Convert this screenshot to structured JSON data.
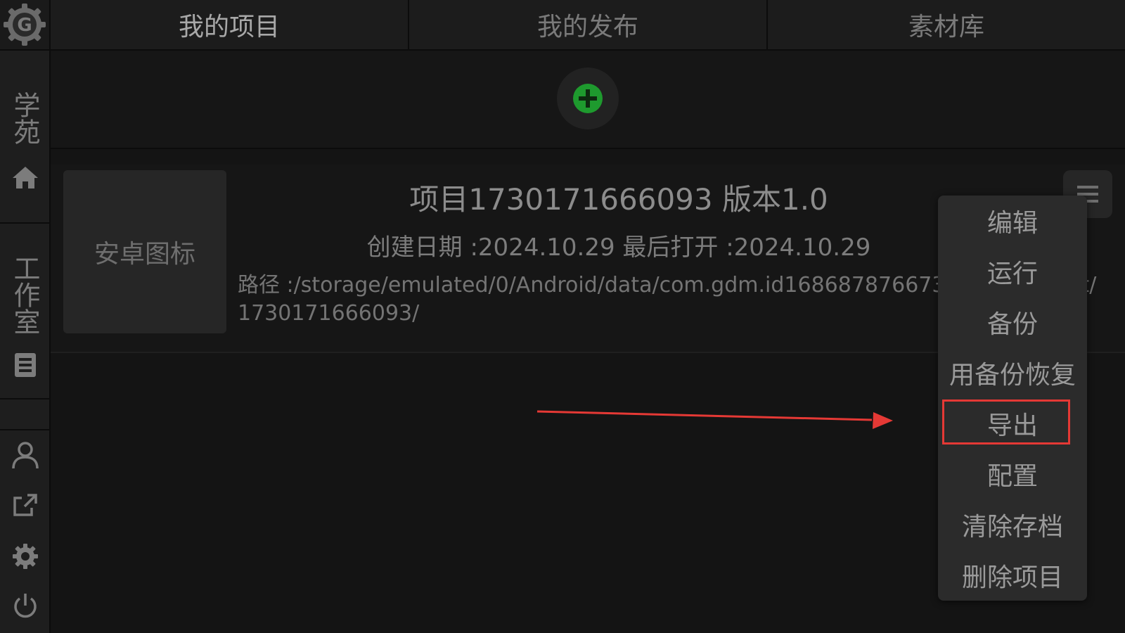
{
  "tabs": [
    {
      "label": "我的项目",
      "active": true
    },
    {
      "label": "我的发布",
      "active": false
    },
    {
      "label": "素材库",
      "active": false
    }
  ],
  "sidebar": {
    "academy_label": "学苑",
    "studio_label": "工作室",
    "icons": [
      "home-icon",
      "document-icon",
      "user-icon",
      "share-icon",
      "gear-icon",
      "power-icon"
    ]
  },
  "project": {
    "icon_label": "安卓图标",
    "title": "项目1730171666093 版本1.0",
    "dates": "创建日期 :2024.10.29 最后打开 :2024.10.29",
    "path": "路径 :/storage/emulated/0/Android/data/com.gdm.id1686878766739/files/project/1730171666093/"
  },
  "menu": {
    "items": [
      "编辑",
      "运行",
      "备份",
      "用备份恢复",
      "导出",
      "配置",
      "清除存档",
      "删除项目"
    ]
  },
  "colors": {
    "accent_green": "#1e9a2e",
    "annotation_red": "#e53935"
  }
}
